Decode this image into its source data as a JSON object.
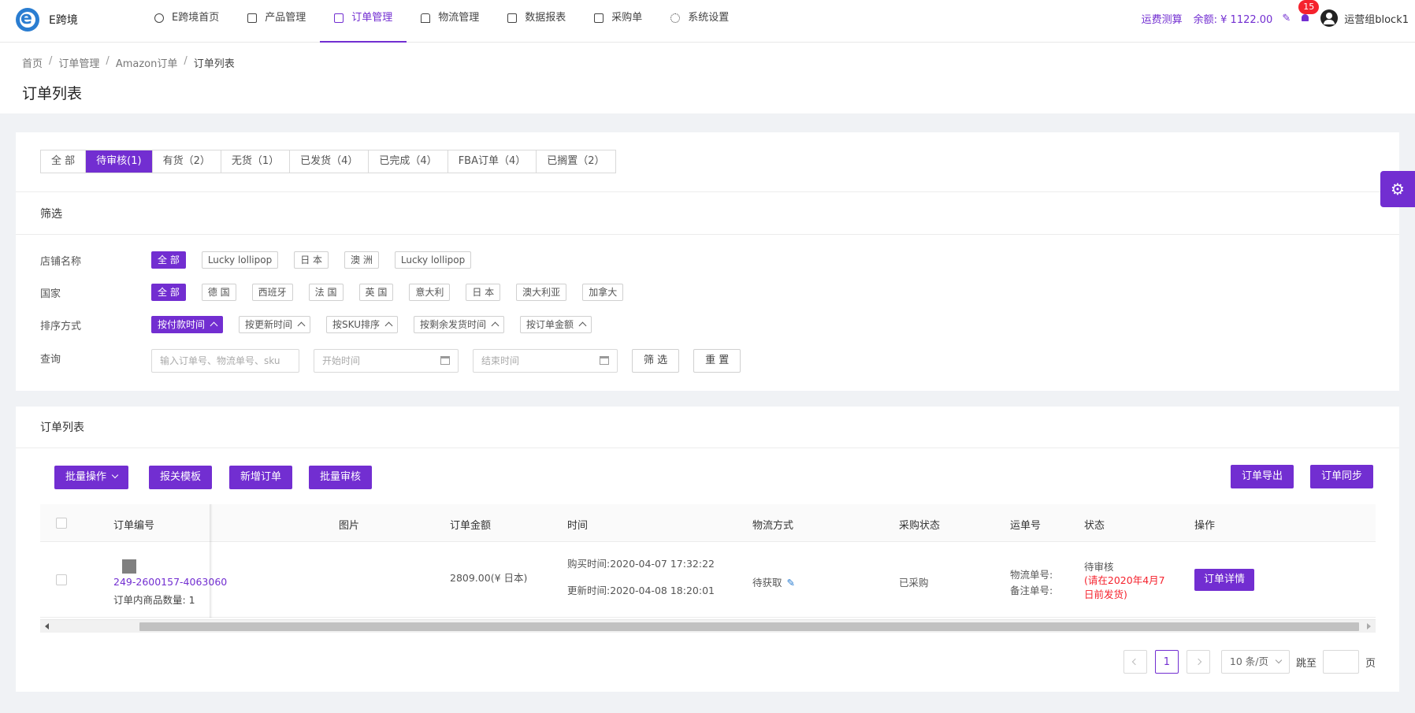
{
  "app": {
    "name": "E跨境"
  },
  "nav": [
    {
      "label": "E跨境首页",
      "icon": "dashboard-icon"
    },
    {
      "label": "产品管理",
      "icon": "box-icon"
    },
    {
      "label": "订单管理",
      "icon": "document-icon",
      "active": true
    },
    {
      "label": "物流管理",
      "icon": "truck-icon"
    },
    {
      "label": "数据报表",
      "icon": "report-icon"
    },
    {
      "label": "采购单",
      "icon": "list-icon"
    },
    {
      "label": "系统设置",
      "icon": "gear-icon"
    }
  ],
  "header": {
    "shipping_calc": "运费测算",
    "balance": "余额: ¥ 1122.00",
    "notifications": "15",
    "username": "运营组block1"
  },
  "breadcrumb": [
    "首页",
    "订单管理",
    "Amazon订单",
    "订单列表"
  ],
  "page_title": "订单列表",
  "tabs": [
    {
      "label": "全 部"
    },
    {
      "label": "待审核(1)",
      "active": true
    },
    {
      "label": "有货（2）"
    },
    {
      "label": "无货（1）"
    },
    {
      "label": "已发货（4）"
    },
    {
      "label": "已完成（4）"
    },
    {
      "label": "FBA订单（4）"
    },
    {
      "label": "已搁置（2）"
    }
  ],
  "filter": {
    "title": "筛选",
    "store": {
      "label": "店铺名称",
      "options": [
        "全 部",
        "Lucky lollipop",
        "日 本",
        "澳 洲",
        "Lucky lollipop"
      ]
    },
    "country": {
      "label": "国家",
      "options": [
        "全 部",
        "德 国",
        "西班牙",
        "法 国",
        "英 国",
        "意大利",
        "日 本",
        "澳大利亚",
        "加拿大"
      ]
    },
    "sort": {
      "label": "排序方式",
      "options": [
        "按付款时间",
        "按更新时间",
        "按SKU排序",
        "按剩余发货时间",
        "按订单金额"
      ]
    },
    "query": {
      "label": "查询",
      "search_placeholder": "输入订单号、物流单号、sku",
      "start_placeholder": "开始时间",
      "end_placeholder": "结束时间",
      "filter_button": "筛 选",
      "reset_button": "重 置"
    }
  },
  "orders": {
    "title": "订单列表",
    "buttons": {
      "batch_ops": "批量操作",
      "customs_template": "报关模板",
      "new_order": "新增订单",
      "batch_review": "批量审核",
      "export": "订单导出",
      "sync": "订单同步"
    },
    "columns": [
      "订单编号",
      "图片",
      "订单金额",
      "时间",
      "物流方式",
      "采购状态",
      "运单号",
      "状态",
      "操作"
    ],
    "rows": [
      {
        "order_no": "249-2600157-4063060",
        "item_count": "订单内商品数量: 1",
        "amount": "2809.00(¥ 日本)",
        "purchase_time": "购买时间:2020-04-07 17:32:22",
        "update_time": "更新时间:2020-04-08 18:20:01",
        "logistics": "待获取",
        "purchase_status": "已采购",
        "tracking_label": "物流单号:",
        "remark_label": "备注单号:",
        "status": "待审核",
        "status_note": "(请在2020年4月7日前发货)",
        "action": "订单详情"
      }
    ]
  },
  "pagination": {
    "current": "1",
    "page_size": "10 条/页",
    "jump_label": "跳至",
    "page_suffix": "页"
  },
  "colors": {
    "accent": "#722ed1",
    "danger": "#f5222d",
    "link": "#2a7dd1"
  }
}
